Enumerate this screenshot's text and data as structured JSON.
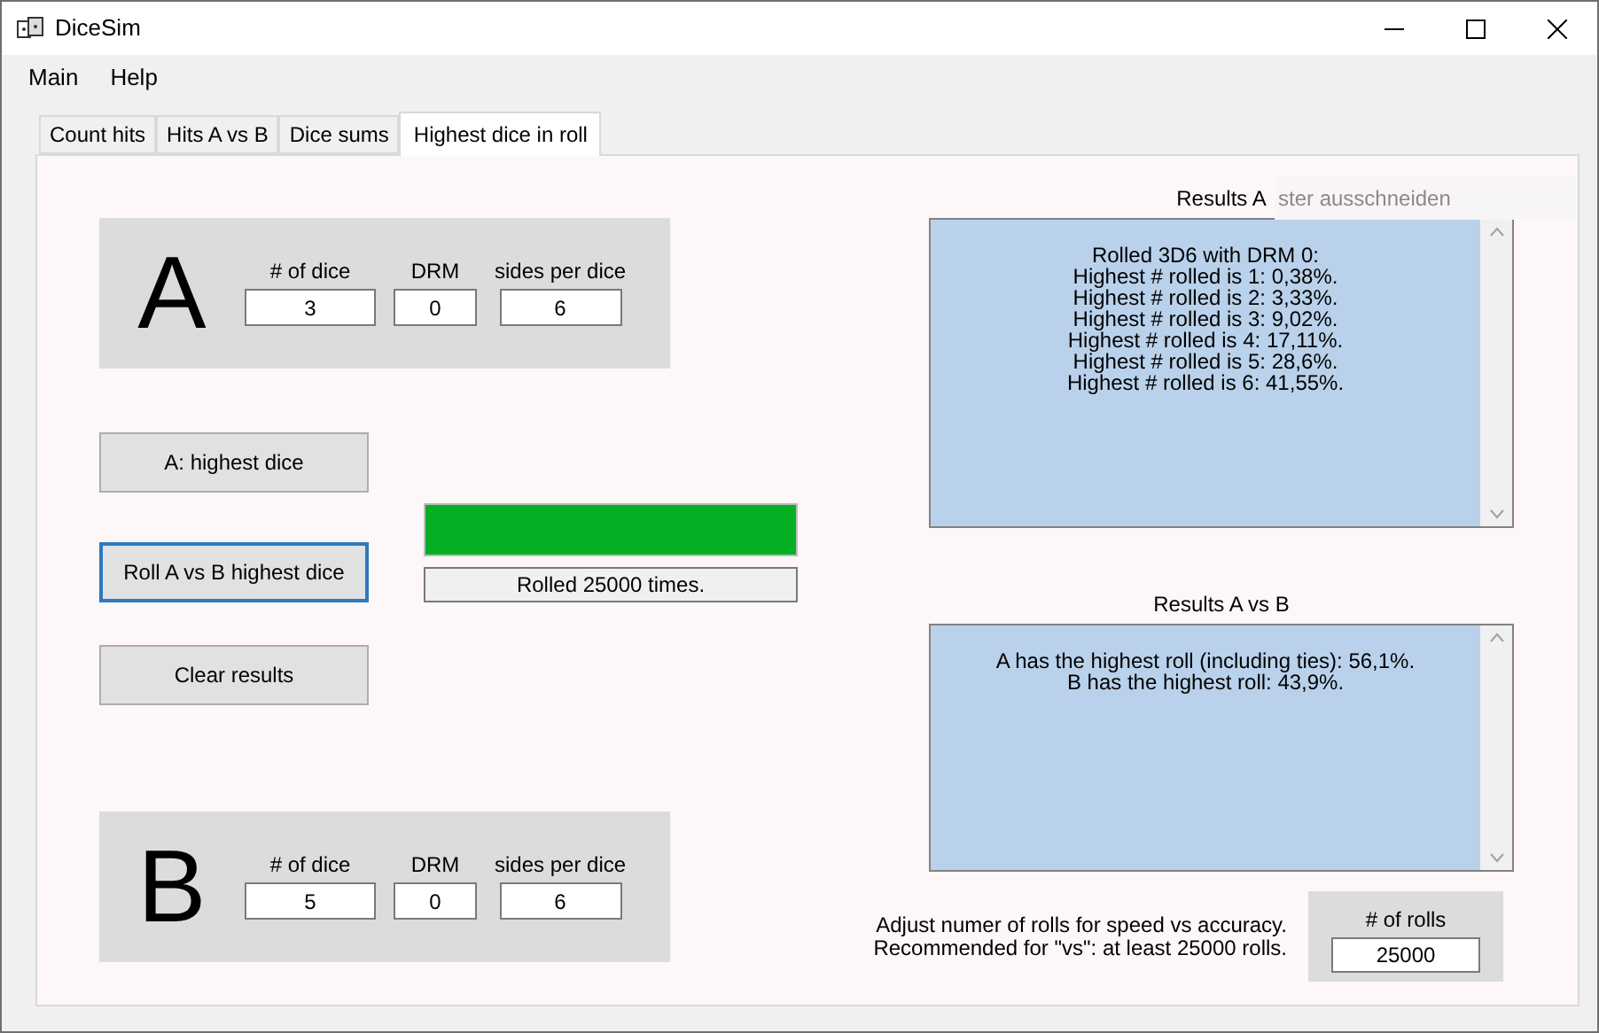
{
  "window": {
    "title": "DiceSim"
  },
  "menu": [
    {
      "label": "Main"
    },
    {
      "label": "Help"
    }
  ],
  "tabs": [
    {
      "label": "Count hits",
      "selected": false
    },
    {
      "label": "Hits A vs B",
      "selected": false
    },
    {
      "label": "Dice sums",
      "selected": false
    },
    {
      "label": "Highest dice in roll",
      "selected": true
    }
  ],
  "group_a": {
    "letter": "A",
    "fields": [
      {
        "label": "# of dice",
        "value": "3"
      },
      {
        "label": "DRM",
        "value": "0"
      },
      {
        "label": "sides per dice",
        "value": "6"
      }
    ]
  },
  "buttons": [
    {
      "label": "A: highest dice",
      "focused": false
    },
    {
      "label": "Roll A vs B highest dice",
      "focused": true
    },
    {
      "label": "Clear results",
      "focused": false
    }
  ],
  "progress": {
    "level": 1.0,
    "status": "Rolled 25000 times."
  },
  "group_b": {
    "letter": "B",
    "fields": [
      {
        "label": "# of dice",
        "value": "5"
      },
      {
        "label": "DRM",
        "value": "0"
      },
      {
        "label": "sides per dice",
        "value": "6"
      }
    ]
  },
  "results_a": {
    "label": "Results A",
    "lines": [
      "Rolled 3D6 with DRM 0:",
      "Highest # rolled is 1: 0,38%.",
      "Highest # rolled is 2: 3,33%.",
      "Highest # rolled is 3: 9,02%.",
      "Highest # rolled is 4: 17,11%.",
      "Highest # rolled is 5: 28,6%.",
      "Highest # rolled is 6: 41,55%."
    ]
  },
  "tooltip": {
    "text": "ster ausschneiden"
  },
  "results_ab": {
    "label": "Results A vs B",
    "lines": [
      "A has the highest roll (including ties): 56,1%.",
      "B has the highest roll: 43,9%."
    ]
  },
  "hint": {
    "lines": [
      "Adjust numer of rolls for speed vs accuracy.",
      "Recommended for \"vs\": at least 25000 rolls."
    ]
  },
  "rolls": {
    "label": "# of rolls",
    "value": "25000"
  }
}
